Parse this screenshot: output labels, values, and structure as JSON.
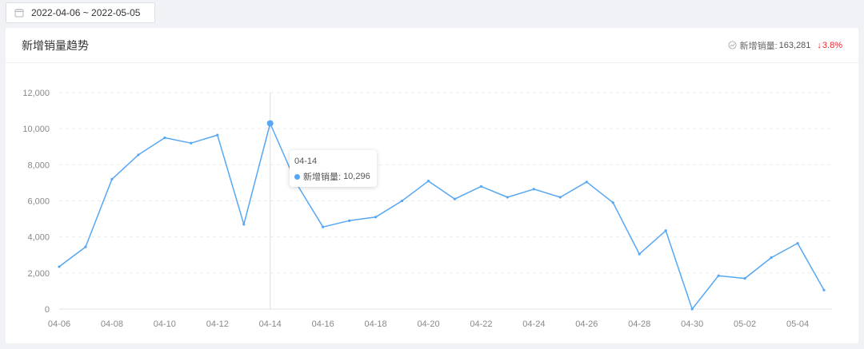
{
  "date_range": {
    "value": "2022-04-06 ~ 2022-05-05",
    "icon": "calendar-icon"
  },
  "card": {
    "title": "新增销量趋势",
    "summary_label": "新增销量:",
    "summary_value": "163,281",
    "change_text": "3.8%",
    "change_direction_icon": "arrow-down-icon",
    "summary_icon": "trend-icon"
  },
  "tooltip": {
    "title": "04-14",
    "series_label": "新增销量:",
    "value": "10,296"
  },
  "colors": {
    "line": "#57a7f3",
    "negative": "#f5222d"
  },
  "chart_data": {
    "type": "line",
    "title": "新增销量趋势",
    "xlabel": "",
    "ylabel": "",
    "ylim": [
      0,
      12000
    ],
    "yticks": [
      "0",
      "2,000",
      "4,000",
      "6,000",
      "8,000",
      "10,000",
      "12,000"
    ],
    "xtick_labels": [
      "04-06",
      "04-08",
      "04-10",
      "04-12",
      "04-14",
      "04-16",
      "04-18",
      "04-20",
      "04-22",
      "04-24",
      "04-26",
      "04-28",
      "04-30",
      "05-02",
      "05-04"
    ],
    "grid": "horizontal-dashed",
    "legend": "none",
    "x": [
      "04-06",
      "04-07",
      "04-08",
      "04-09",
      "04-10",
      "04-11",
      "04-12",
      "04-13",
      "04-14",
      "04-15",
      "04-16",
      "04-17",
      "04-18",
      "04-19",
      "04-20",
      "04-21",
      "04-22",
      "04-23",
      "04-24",
      "04-25",
      "04-26",
      "04-27",
      "04-28",
      "04-29",
      "04-30",
      "05-01",
      "05-02",
      "05-03",
      "05-04",
      "05-05"
    ],
    "series": [
      {
        "name": "新增销量",
        "values": [
          2350,
          3450,
          7200,
          8550,
          9500,
          9200,
          9650,
          4700,
          10296,
          6950,
          4550,
          4900,
          5100,
          6000,
          7100,
          6100,
          6800,
          6200,
          6650,
          6200,
          7050,
          5900,
          3050,
          4350,
          0,
          1850,
          1700,
          2850,
          3650,
          1050
        ]
      }
    ],
    "highlight": {
      "x": "04-14",
      "value": 10296
    }
  }
}
